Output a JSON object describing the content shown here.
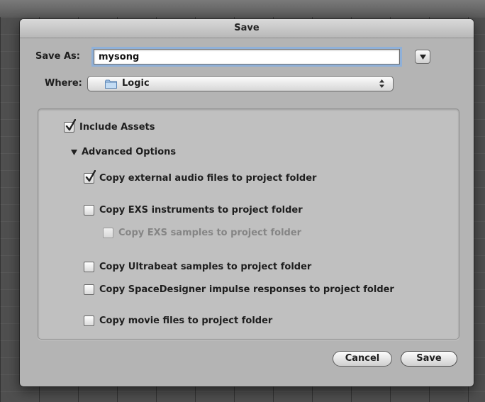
{
  "dialog": {
    "title": "Save"
  },
  "save_as": {
    "label": "Save As:",
    "value": "mysong"
  },
  "where": {
    "label": "Where:",
    "value": "Logic",
    "icon": "folder-icon"
  },
  "options": {
    "include_assets": {
      "label": "Include Assets",
      "checked": true
    },
    "advanced_label": "Advanced Options",
    "copy_audio": {
      "label": "Copy external audio files to project folder",
      "checked": true
    },
    "copy_exs": {
      "label": "Copy EXS instruments to project folder",
      "checked": false
    },
    "copy_exs_samples": {
      "label": "Copy EXS samples to project folder",
      "checked": false,
      "enabled": false
    },
    "copy_ultrabeat": {
      "label": "Copy Ultrabeat samples to project folder",
      "checked": false
    },
    "copy_spacedesigner": {
      "label": "Copy SpaceDesigner impulse responses to project folder",
      "checked": false
    },
    "copy_movie": {
      "label": "Copy movie files to project folder",
      "checked": false
    }
  },
  "buttons": {
    "cancel_label": "Cancel",
    "save_label": "Save"
  }
}
